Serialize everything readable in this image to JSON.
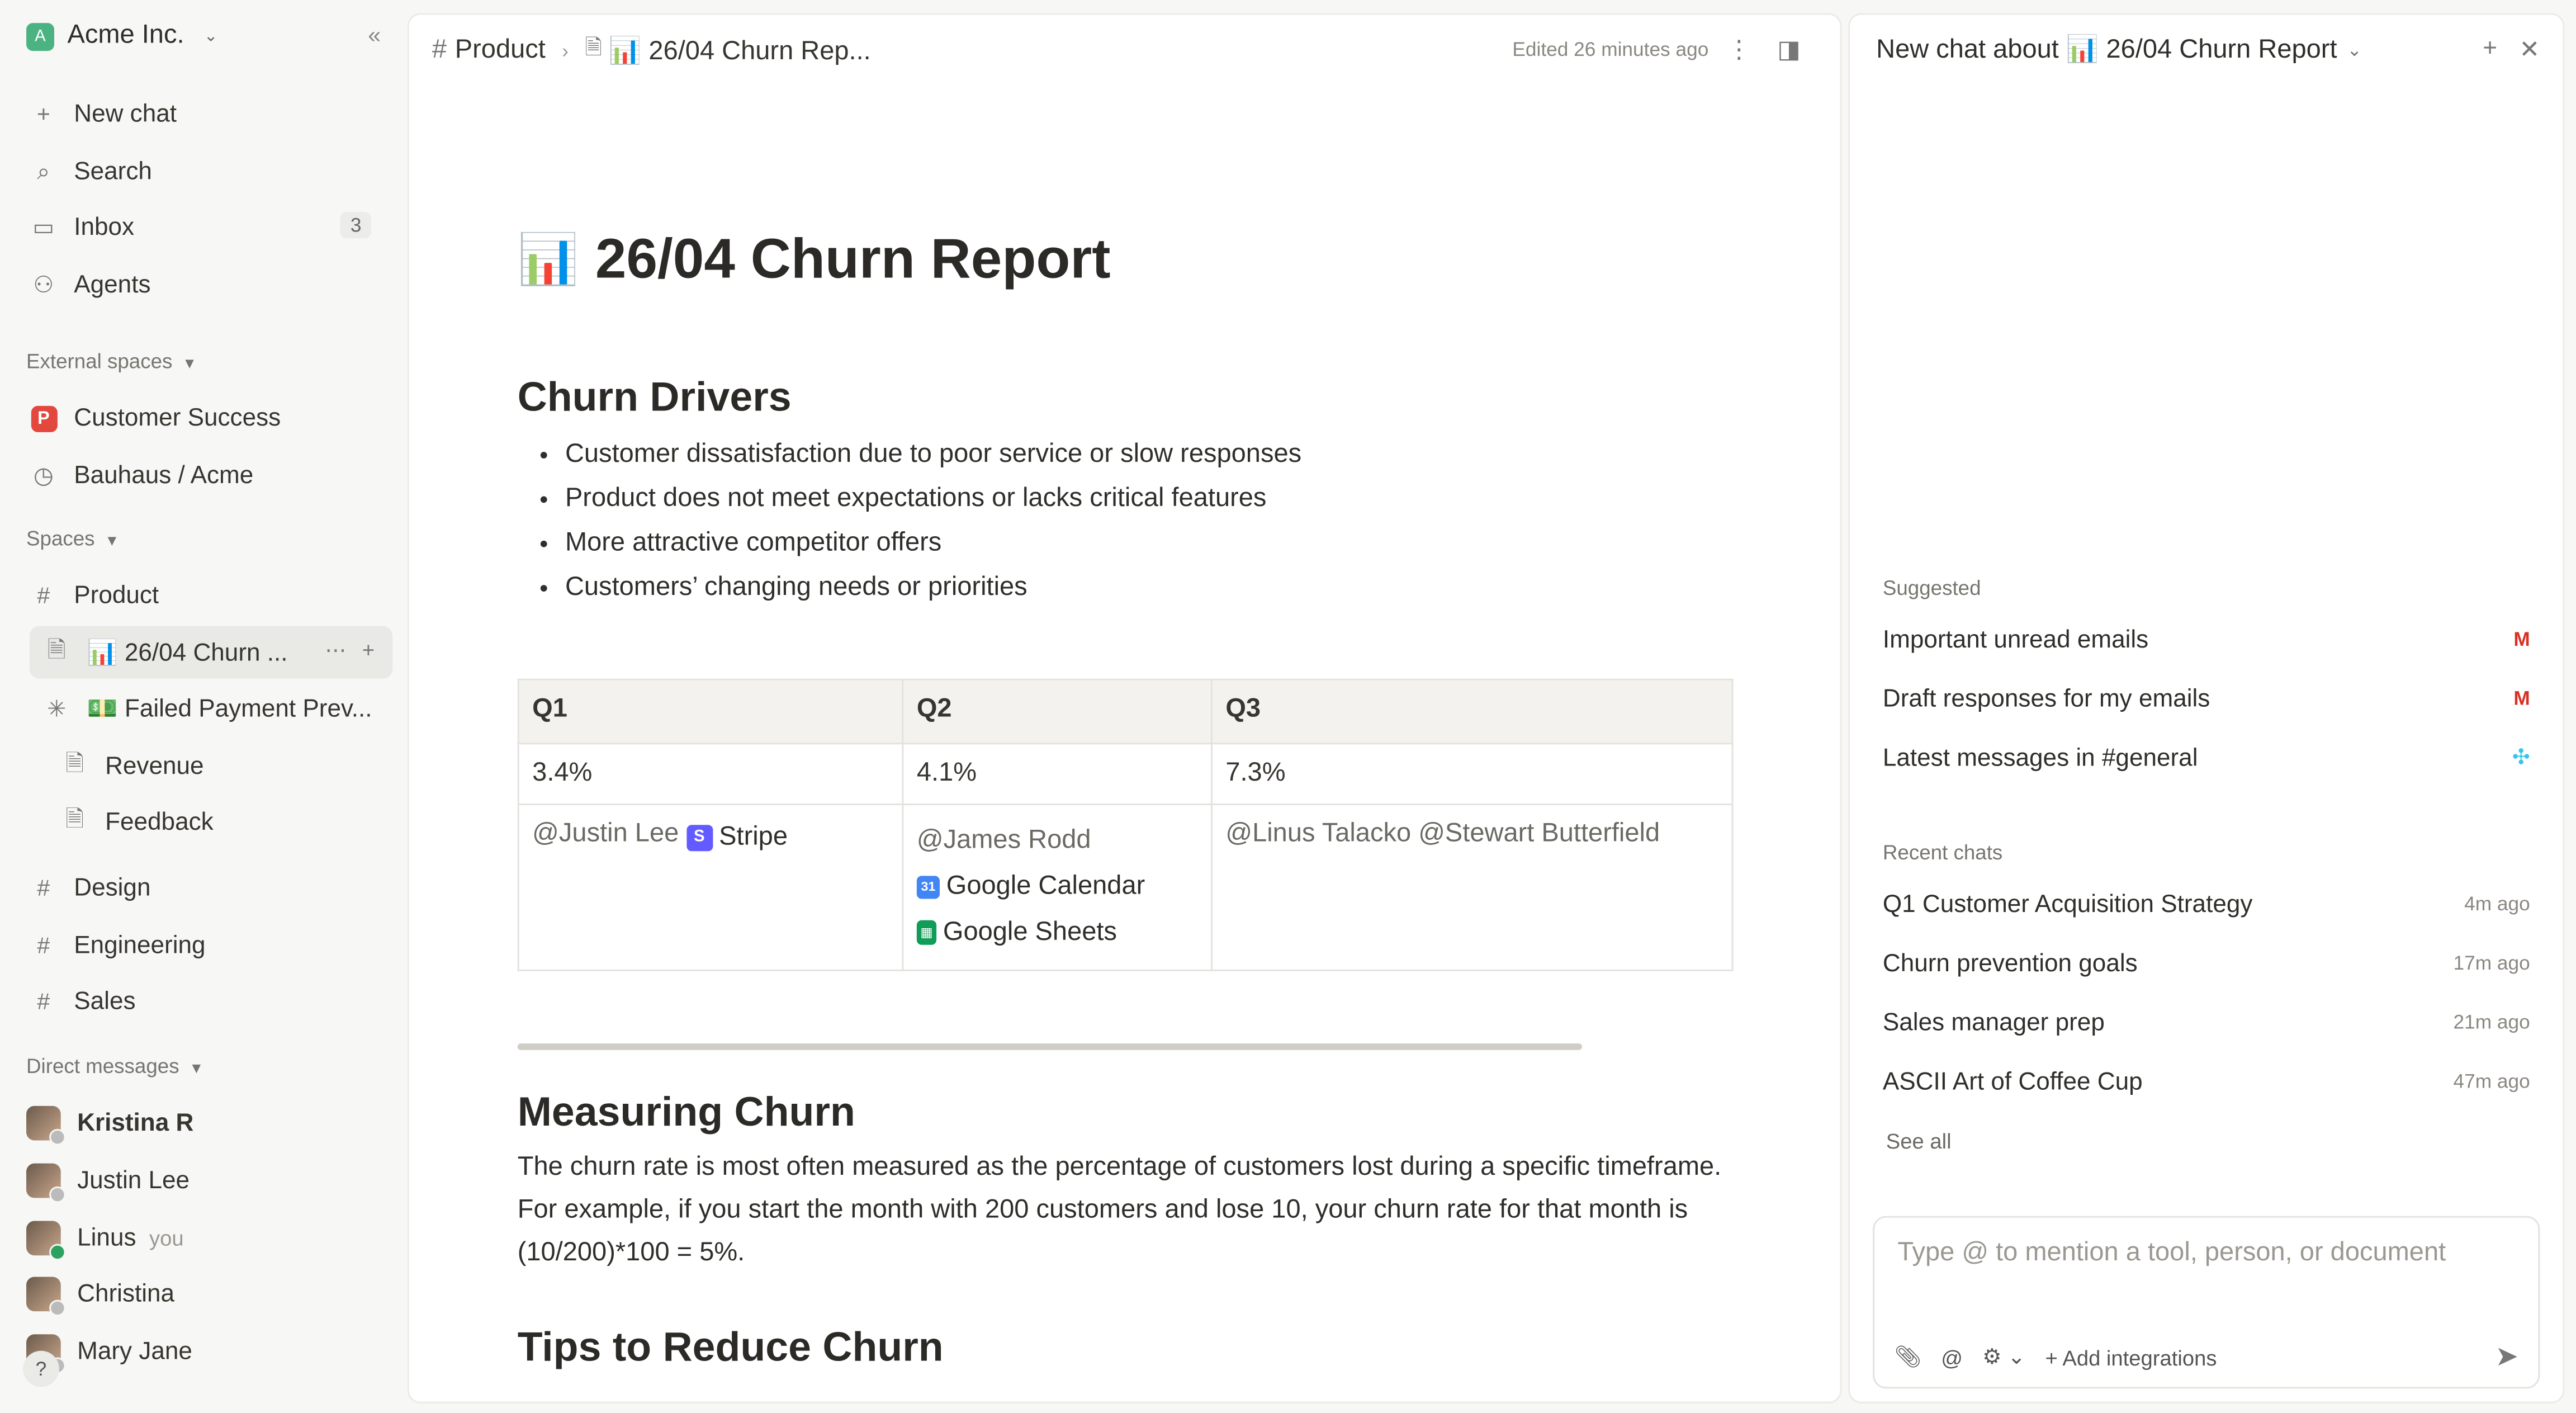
{
  "sidebar": {
    "workspace": {
      "name": "Acme Inc.",
      "initial": "A"
    },
    "nav": [
      {
        "label": "New chat",
        "icon": "plus-icon"
      },
      {
        "label": "Search",
        "icon": "search-icon"
      },
      {
        "label": "Inbox",
        "icon": "inbox-icon",
        "badge": "3"
      },
      {
        "label": "Agents",
        "icon": "agents-icon"
      }
    ],
    "external_spaces_label": "External spaces",
    "external_spaces": [
      {
        "label": "Customer Success",
        "icon": "pitch-icon"
      },
      {
        "label": "Bauhaus / Acme",
        "icon": "clock-icon"
      }
    ],
    "spaces_label": "Spaces",
    "spaces": {
      "product": "Product",
      "pages": [
        {
          "label": "📊 26/04 Churn ...",
          "active": true
        },
        {
          "label": "💵 Failed Payment Prev..."
        },
        {
          "label": "Revenue"
        },
        {
          "label": "Feedback"
        }
      ],
      "others": [
        "Design",
        "Engineering",
        "Sales"
      ]
    },
    "dm_label": "Direct messages",
    "dms": [
      {
        "name": "Kristina R",
        "bold": true,
        "status": "away"
      },
      {
        "name": "Justin Lee",
        "status": "away"
      },
      {
        "name": "Linus",
        "you": "you",
        "status": "online"
      },
      {
        "name": "Christina",
        "status": "away"
      },
      {
        "name": "Mary Jane",
        "status": "away"
      }
    ],
    "help": "?"
  },
  "doc_header": {
    "breadcrumb_space": "Product",
    "breadcrumb_doc": "📊 26/04 Churn Rep...",
    "edited": "Edited 26 minutes ago"
  },
  "doc": {
    "title": "26/04 Churn Report",
    "title_icon": "📊",
    "drivers_heading": "Churn Drivers",
    "drivers": [
      "Customer dissatisfaction due to poor service or slow responses",
      "Product does not meet expectations or lacks critical features",
      "More attractive competitor offers",
      "Customers’ changing needs or priorities"
    ],
    "table": {
      "headers": [
        "Q1",
        "Q2",
        "Q3"
      ],
      "rates": [
        "3.4%",
        "4.1%",
        "7.3%"
      ],
      "q1_mention": "@Justin Lee",
      "q1_tool": "Stripe",
      "q2_mention": "@James Rodd",
      "q2_tool_1": "Google Calendar",
      "q2_tool_2": "Google Sheets",
      "q3_mentions": "@Linus Talacko @Stewart Butterfield"
    },
    "measuring_heading": "Measuring Churn",
    "measuring_text": "The churn rate is most often measured as the percentage of customers lost during a specific timeframe. For example, if you start the month with 200 customers and lose 10, your churn rate for that month is (10/200)*100 = 5%.",
    "tips_heading": "Tips to Reduce Churn"
  },
  "chat": {
    "title": "New chat about 📊 26/04 Churn Report",
    "suggested_label": "Suggested",
    "suggested": [
      {
        "label": "Important unread emails",
        "icon": "gmail-icon"
      },
      {
        "label": "Draft responses for my emails",
        "icon": "gmail-icon"
      },
      {
        "label": "Latest messages in #general",
        "icon": "slack-icon"
      }
    ],
    "recent_label": "Recent chats",
    "recent": [
      {
        "label": "Q1 Customer Acquisition Strategy",
        "ago": "4m ago"
      },
      {
        "label": "Churn prevention goals",
        "ago": "17m ago"
      },
      {
        "label": "Sales manager prep",
        "ago": "21m ago"
      },
      {
        "label": "ASCII Art of Coffee Cup",
        "ago": "47m ago"
      }
    ],
    "see_all": "See all",
    "composer_placeholder": "Type @ to mention a tool, person, or document",
    "add_integrations": "Add integrations"
  },
  "colors": {
    "accent": "#4bb381",
    "stripe": "#635bff",
    "gmail_red": "#d93025"
  }
}
